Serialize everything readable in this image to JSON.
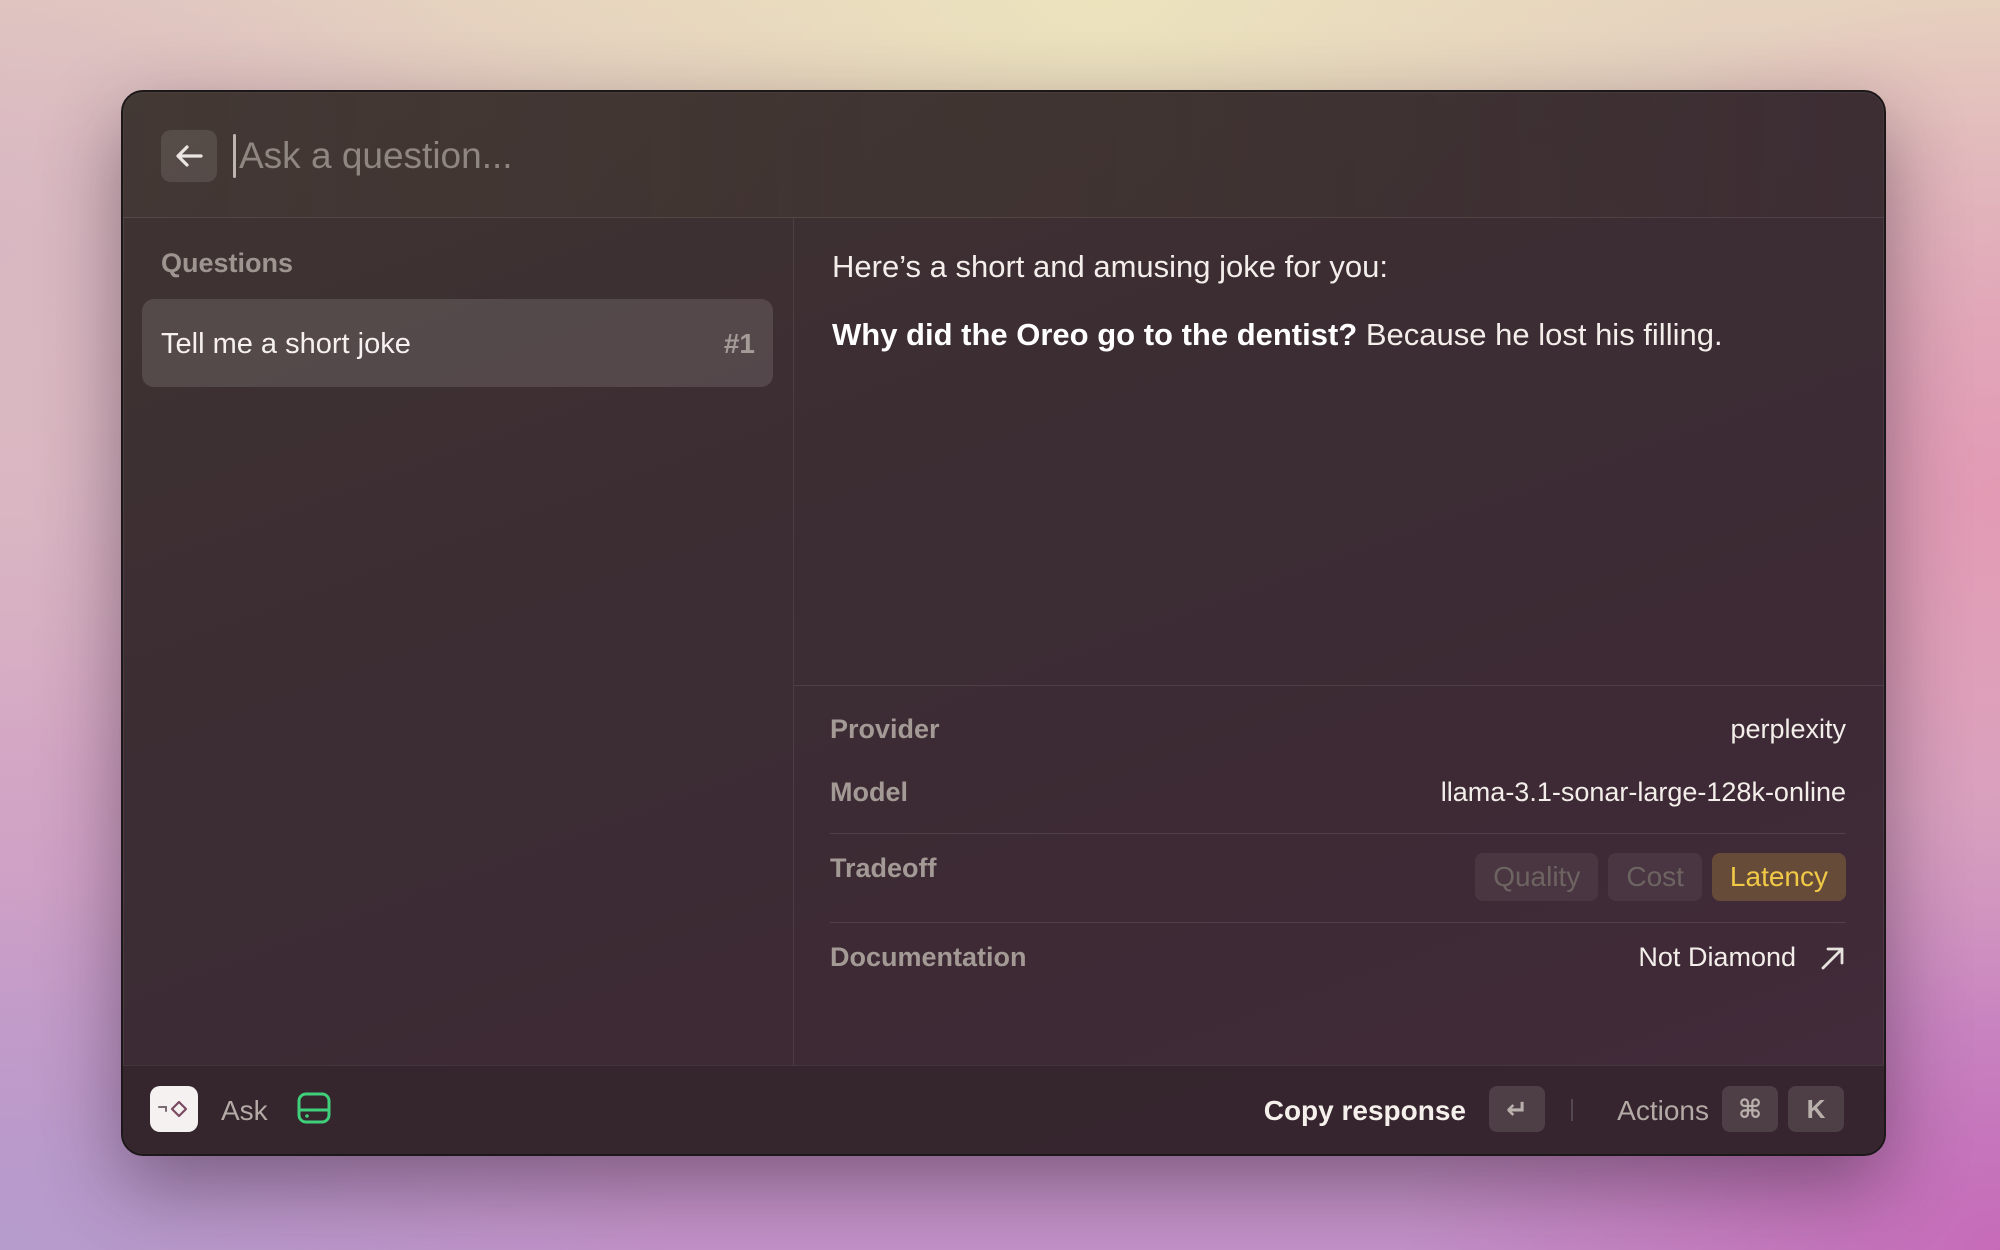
{
  "search": {
    "placeholder": "Ask a question..."
  },
  "sidebar": {
    "title": "Questions",
    "items": [
      {
        "label": "Tell me a short joke",
        "number": "#1",
        "selected": true
      }
    ]
  },
  "response": {
    "intro": "Here’s a short and amusing joke for you:",
    "question": "Why did the Oreo go to the dentist?",
    "answer": " Because he lost his filling."
  },
  "metadata": {
    "provider": {
      "label": "Provider",
      "value": "perplexity"
    },
    "model": {
      "label": "Model",
      "value": "llama-3.1-sonar-large-128k-online"
    },
    "tradeoff": {
      "label": "Tradeoff",
      "options": [
        "Quality",
        "Cost",
        "Latency"
      ],
      "selected": "Latency"
    },
    "documentation": {
      "label": "Documentation",
      "link_text": "Not Diamond"
    }
  },
  "footer": {
    "ask_label": "Ask",
    "copy_label": "Copy response",
    "copy_key": "↵",
    "actions_label": "Actions",
    "actions_keys": [
      "⌘",
      "K"
    ]
  },
  "colors": {
    "active_chip_text": "#f0c947",
    "agent_icon": "#3fcf7a"
  }
}
